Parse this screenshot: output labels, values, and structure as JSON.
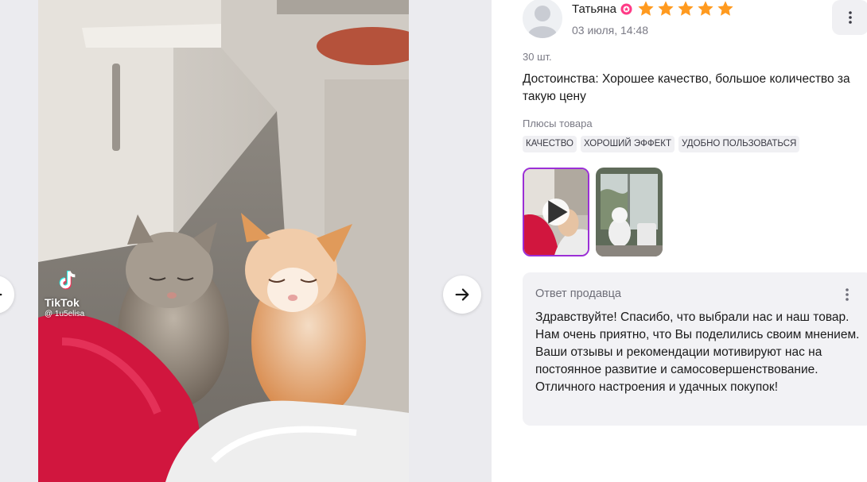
{
  "media": {
    "watermark_brand": "TikTok",
    "watermark_user": "@ 1u5elisa"
  },
  "review": {
    "author_name": "Татьяна",
    "rating": 5,
    "date": "03 июля, 14:48",
    "quantity": "30 шт.",
    "pros_text": "Достоинства: Хорошее качество, большое количество за такую цену",
    "tags_title": "Плюсы товара",
    "tags": [
      "КАЧЕСТВО",
      "ХОРОШИЙ ЭФФЕКТ",
      "УДОБНО ПОЛЬЗОВАТЬСЯ"
    ],
    "thumbnails": [
      {
        "kind": "video",
        "active": true
      },
      {
        "kind": "photo",
        "active": false
      }
    ]
  },
  "seller_reply": {
    "title": "Ответ продавца",
    "text": "Здравствуйте! Спасибо, что выбрали нас и наш товар. Нам очень приятно, что Вы поделились своим мнением. Ваши отзывы и рекомендации мотивируют нас на постоянное развитие и самосовершенствование. Отличного настроения и удачных покупок!"
  },
  "colors": {
    "star": "#ff9a1f",
    "accent_border": "#9b2fd6",
    "badge": "#ff3a86",
    "muted_text": "#7a7a85"
  },
  "icons": [
    "arrow-left-icon",
    "arrow-right-icon",
    "kebab-menu-icon",
    "star-icon",
    "badge-icon",
    "play-icon",
    "avatar-icon",
    "tiktok-logo-icon"
  ]
}
